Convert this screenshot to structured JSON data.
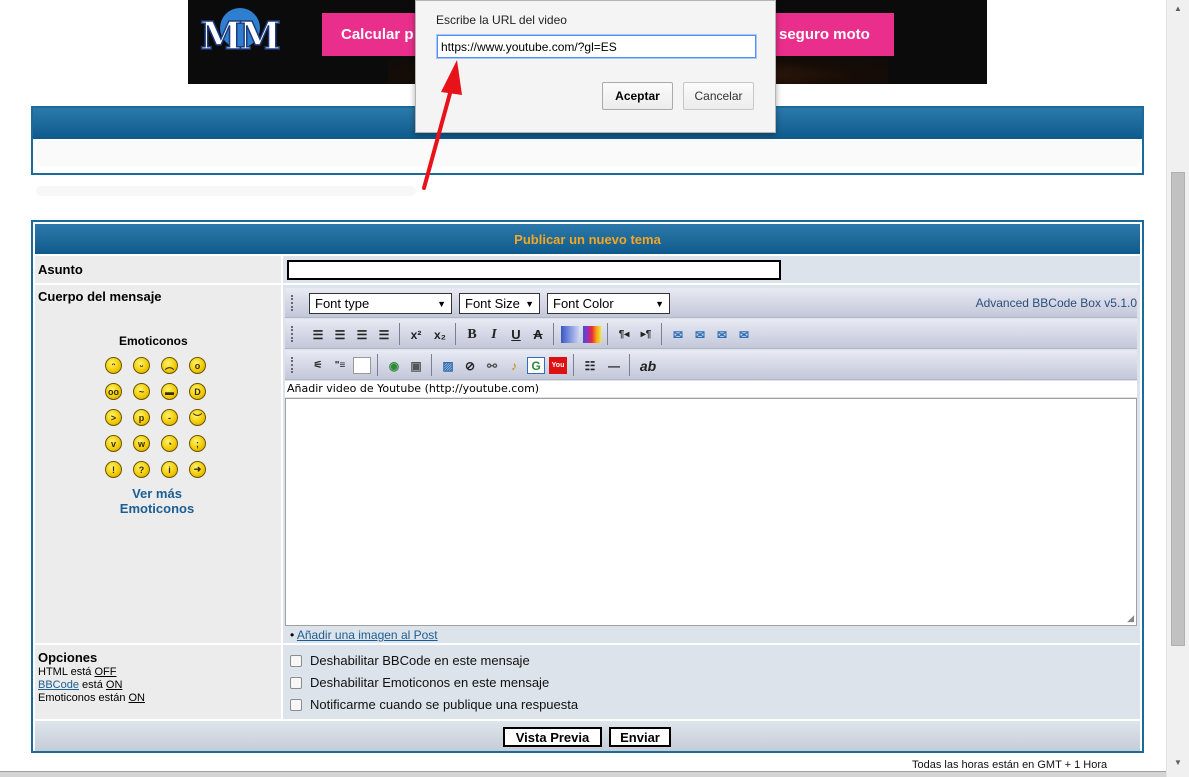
{
  "banner": {
    "logo_text": "MM",
    "button_left": "Calcular p",
    "button_right": "seguro moto"
  },
  "dialog": {
    "prompt": "Escribe la URL del video",
    "input_value": "https://www.youtube.com/?gl=ES",
    "ok_label": "Aceptar",
    "cancel_label": "Cancelar"
  },
  "form": {
    "title": "Publicar un nuevo tema",
    "subject_label": "Asunto",
    "body_label": "Cuerpo del mensaje",
    "emoticons_title": "Emoticonos",
    "emoticons_more_line1": "Ver más",
    "emoticons_more_line2": "Emoticonos",
    "font_type": "Font type",
    "font_size": "Font Size",
    "font_color": "Font Color",
    "bbcode_version": "Advanced BBCode Box v5.1.0",
    "status_hint": "Añadir video de Youtube (http://youtube.com)",
    "add_image_link": "Añadir una imagen al Post",
    "options_label": "Opciones",
    "html_status_prefix": "HTML está ",
    "html_status_value": "OFF",
    "bbcode_link": "BBCode",
    "bbcode_status_mid": " está ",
    "bbcode_status_value": "ON",
    "emoticons_status_prefix": "Emoticonos están ",
    "emoticons_status_value": "ON",
    "checkbox_disable_bbcode": "Deshabilitar BBCode en este mensaje",
    "checkbox_disable_emoticons": "Deshabilitar Emoticonos en este mensaje",
    "checkbox_notify": "Notificarme cuando se publique una respuesta",
    "preview_button": "Vista Previa",
    "submit_button": "Enviar"
  },
  "toolbar_icons": {
    "row2": [
      "justify-icon",
      "align-right-icon",
      "align-center-icon",
      "align-left-icon",
      "superscript-icon",
      "subscript-icon",
      "bold-icon",
      "italic-icon",
      "underline-icon",
      "strikethrough-icon",
      "gradient-icon",
      "rainbow-icon",
      "ltr-icon",
      "rtl-icon",
      "mail-icon-1",
      "mail-icon-2",
      "mail-icon-3",
      "mail-icon-4"
    ],
    "row3": [
      "code-icon",
      "quote-icon",
      "box-icon",
      "web-icon",
      "flash-icon",
      "image-icon",
      "compass-icon",
      "stream-icon",
      "sound-icon",
      "google-icon",
      "youtube-icon",
      "list-icon",
      "hr-icon",
      "spell-icon"
    ],
    "bold_glyph": "B",
    "italic_glyph": "I",
    "underline_glyph": "U",
    "strike_glyph": "A",
    "spell_glyph": "ab",
    "google_glyph": "G",
    "youtube_glyph": "You"
  },
  "footer": {
    "timezone": "Todas las horas están en GMT + 1 Hora"
  },
  "colors": {
    "accent_blue": "#1b6a9c",
    "title_orange": "#f5a623",
    "banner_pink": "#ea2e8c",
    "arrow_red": "#e8121a"
  }
}
